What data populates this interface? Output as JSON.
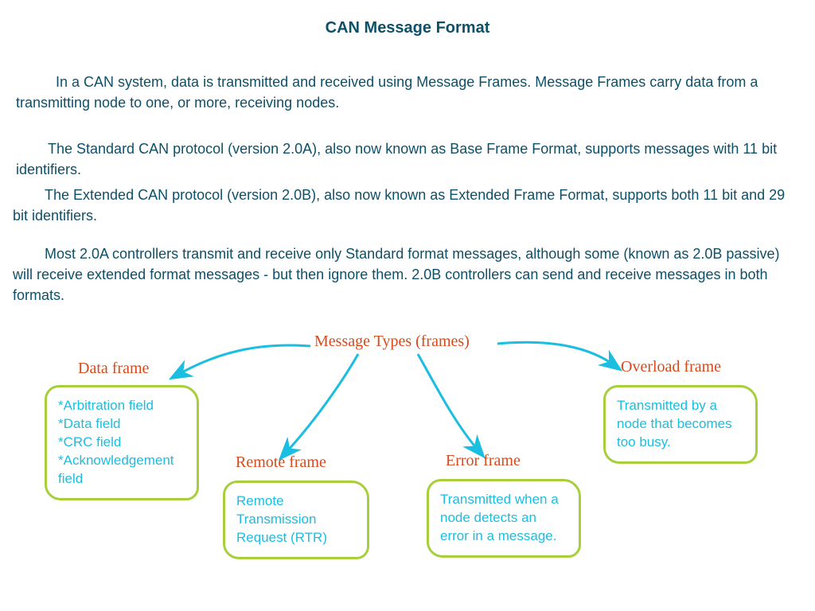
{
  "title": "CAN Message Format",
  "paragraphs": {
    "p1": "In a CAN system, data is transmitted and received using Message Frames. Message Frames carry data from a transmitting node to one, or more, receiving nodes.",
    "p2": "The Standard CAN protocol (version 2.0A), also now known as Base Frame Format, supports messages with 11 bit identifiers.",
    "p3": "The Extended CAN protocol (version 2.0B), also now known as Extended Frame Format, supports both 11 bit and 29 bit identifiers.",
    "p4": "Most 2.0A controllers transmit and receive only Standard format messages, although some (known as 2.0B passive) will receive extended format messages - but then ignore them. 2.0B controllers can send and receive messages in both formats."
  },
  "diagram": {
    "root": "Message Types (frames)",
    "branches": {
      "data": {
        "label": "Data frame",
        "body": "*Arbitration field\n*Data field\n*CRC field\n*Acknowledgement field"
      },
      "remote": {
        "label": "Remote frame",
        "body": "Remote Transmission Request (RTR)"
      },
      "error": {
        "label": "Error frame",
        "body": "Transmitted when a node detects an error in a message."
      },
      "overload": {
        "label": "Overload frame",
        "body": "Transmitted by a node that becomes too busy."
      }
    }
  },
  "colors": {
    "text": "#0d5068",
    "accent": "#d84a1b",
    "arrow": "#1abee0",
    "box_border": "#a7cf3b",
    "box_text": "#1abee0"
  }
}
